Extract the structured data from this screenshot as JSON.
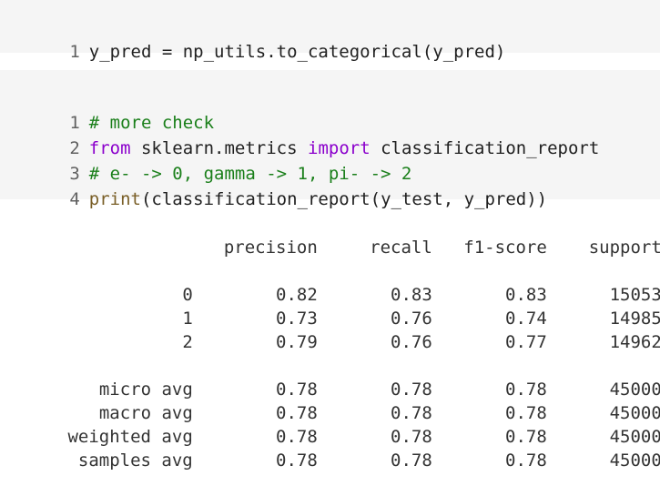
{
  "cell1": {
    "line_numbers": [
      "1"
    ],
    "lines": [
      {
        "a": "y_pred = np_utils.to_categorical(y_pred)"
      }
    ]
  },
  "cell2": {
    "line_numbers": [
      "1",
      "2",
      "3",
      "4"
    ],
    "line1_comment": "# more check",
    "line2_from": "from",
    "line2_module": " sklearn.metrics ",
    "line2_import": "import",
    "line2_name": " classification_report",
    "line3_comment": "# e- -> 0, gamma -> 1, pi- -> 2",
    "line4_print": "print",
    "line4_rest": "(classification_report(y_test, y_pred))"
  },
  "report": {
    "header": [
      "",
      "precision",
      "recall",
      "f1-score",
      "support"
    ],
    "rows": [
      [
        "0",
        "0.82",
        "0.83",
        "0.83",
        "15053"
      ],
      [
        "1",
        "0.73",
        "0.76",
        "0.74",
        "14985"
      ],
      [
        "2",
        "0.79",
        "0.76",
        "0.77",
        "14962"
      ]
    ],
    "avg_rows": [
      [
        "micro avg",
        "0.78",
        "0.78",
        "0.78",
        "45000"
      ],
      [
        "macro avg",
        "0.78",
        "0.78",
        "0.78",
        "45000"
      ],
      [
        "weighted avg",
        "0.78",
        "0.78",
        "0.78",
        "45000"
      ],
      [
        "samples avg",
        "0.78",
        "0.78",
        "0.78",
        "45000"
      ]
    ]
  },
  "colors": {
    "cell_bg": "#f5f5f5",
    "keyword": "#8b00cc",
    "comment": "#1a7f1a",
    "builtin": "#795e26"
  }
}
